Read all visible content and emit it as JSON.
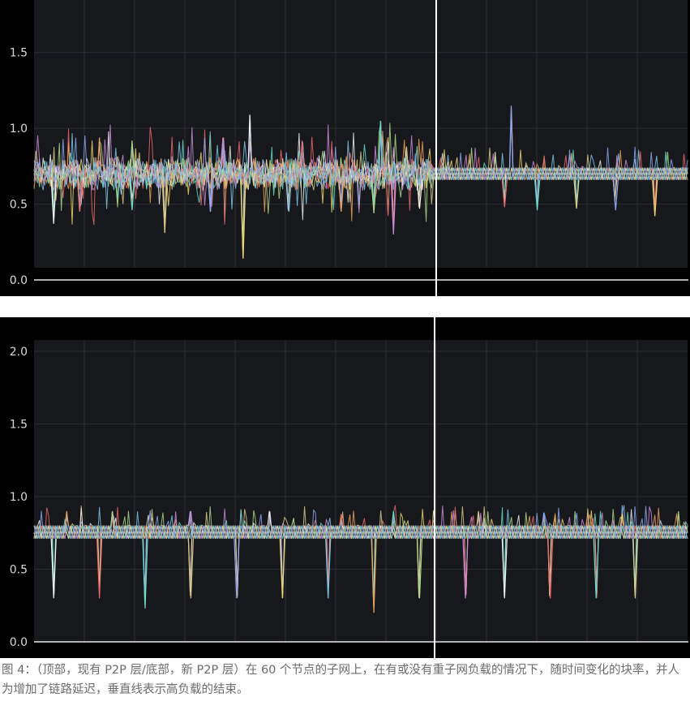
{
  "chart_data": [
    {
      "type": "line",
      "panel": "top",
      "ylim": [
        0,
        1.9
      ],
      "yticks": [
        "0.0",
        "0.5",
        "1.0",
        "1.5"
      ],
      "ytick_values": [
        0,
        0.5,
        1.0,
        1.5
      ],
      "x_range": [
        0,
        100
      ],
      "vertical_marker_x": 61,
      "baseline": 0.7,
      "band": [
        0.66,
        0.74
      ],
      "spikes_down": [
        {
          "x": 3,
          "y": 0.37
        },
        {
          "x": 7,
          "y": 0.45
        },
        {
          "x": 15,
          "y": 0.46
        },
        {
          "x": 20,
          "y": 0.31
        },
        {
          "x": 27,
          "y": 0.45
        },
        {
          "x": 32,
          "y": 0.14
        },
        {
          "x": 39,
          "y": 0.45
        },
        {
          "x": 47,
          "y": 0.45
        },
        {
          "x": 52,
          "y": 0.44
        },
        {
          "x": 55,
          "y": 0.3
        },
        {
          "x": 59,
          "y": 0.47
        },
        {
          "x": 72,
          "y": 0.48
        },
        {
          "x": 77,
          "y": 0.46
        },
        {
          "x": 83,
          "y": 0.47
        },
        {
          "x": 89,
          "y": 0.46
        },
        {
          "x": 95,
          "y": 0.42
        }
      ],
      "spikes_up": [
        {
          "x": 10,
          "y": 0.94
        },
        {
          "x": 15,
          "y": 0.92
        },
        {
          "x": 29,
          "y": 0.94
        },
        {
          "x": 33,
          "y": 1.09
        },
        {
          "x": 41,
          "y": 0.92
        },
        {
          "x": 53,
          "y": 1.05
        },
        {
          "x": 57,
          "y": 0.88
        },
        {
          "x": 73,
          "y": 1.15
        }
      ]
    },
    {
      "type": "line",
      "panel": "bottom",
      "ylim": [
        0,
        2.15
      ],
      "yticks": [
        "0.0",
        "0.5",
        "1.0",
        "1.5",
        "2.0"
      ],
      "ytick_values": [
        0,
        0.5,
        1.0,
        1.5,
        2.0
      ],
      "x_range": [
        0,
        100
      ],
      "vertical_marker_x": 61,
      "baseline": 0.75,
      "band": [
        0.71,
        0.8
      ],
      "spikes_down": [
        {
          "x": 3,
          "y": 0.3
        },
        {
          "x": 10,
          "y": 0.3
        },
        {
          "x": 17,
          "y": 0.23
        },
        {
          "x": 24,
          "y": 0.3
        },
        {
          "x": 31,
          "y": 0.3
        },
        {
          "x": 38,
          "y": 0.3
        },
        {
          "x": 45,
          "y": 0.3
        },
        {
          "x": 52,
          "y": 0.2
        },
        {
          "x": 59,
          "y": 0.3
        },
        {
          "x": 66,
          "y": 0.3
        },
        {
          "x": 72,
          "y": 0.3
        },
        {
          "x": 79,
          "y": 0.3
        },
        {
          "x": 86,
          "y": 0.3
        },
        {
          "x": 92,
          "y": 0.3
        }
      ],
      "spikes_up": [
        {
          "x": 5,
          "y": 0.9
        },
        {
          "x": 12,
          "y": 0.9
        },
        {
          "x": 24,
          "y": 0.9
        },
        {
          "x": 36,
          "y": 0.9
        },
        {
          "x": 47,
          "y": 0.88
        },
        {
          "x": 55,
          "y": 0.9
        },
        {
          "x": 68,
          "y": 0.9
        },
        {
          "x": 78,
          "y": 0.89
        },
        {
          "x": 90,
          "y": 0.88
        }
      ]
    }
  ],
  "colors": {
    "background": "#000000",
    "plot_background": "#17181c",
    "grid": "#2c2d33",
    "axis_text": "#d8d8d8",
    "marker": "#ffffff",
    "series": [
      "#f2d36b",
      "#7cc6e8",
      "#e8a05c",
      "#a8d98a",
      "#c98ad9",
      "#f0f0f0",
      "#e86a6a",
      "#6ad9c5",
      "#d9c98a",
      "#8aa8f0"
    ]
  },
  "caption": {
    "text": "图 4：（顶部，现有 P2P 层/底部，新 P2P 层）在 60 个节点的子网上，在有或没有重子网负载的情况下，随时间变化的块率，并人为增加了链路延迟，垂直线表示高负载的结束。"
  }
}
